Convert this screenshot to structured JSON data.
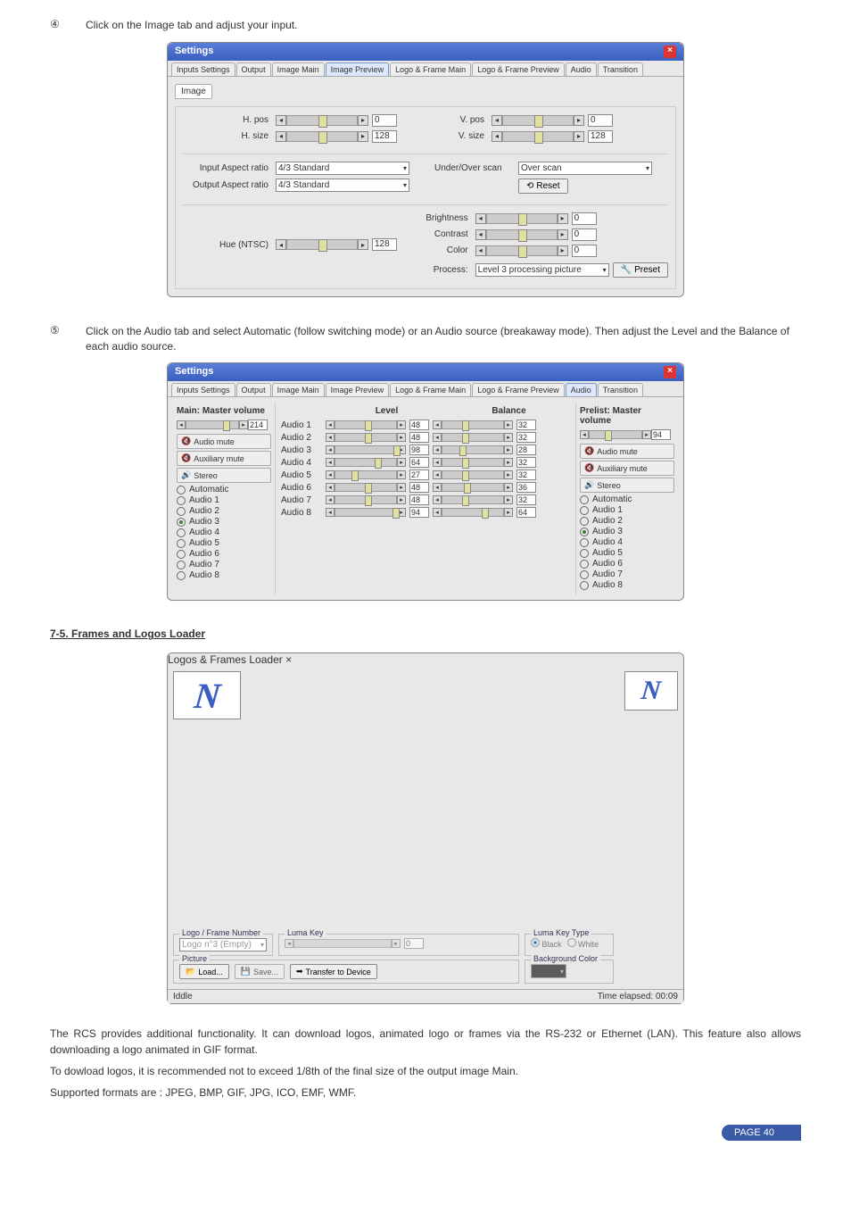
{
  "step4": {
    "num": "④",
    "text": "Click on the Image tab and adjust your input."
  },
  "step5": {
    "num": "⑤",
    "text": "Click on the Audio tab and select Automatic (follow switching mode) or an Audio source (breakaway mode). Then adjust the Level and the Balance of each audio source."
  },
  "settings_dialog": {
    "title": "Settings",
    "tabs": [
      "Inputs Settings",
      "Output",
      "Image Main",
      "Image Preview",
      "Logo & Frame Main",
      "Logo & Frame Preview",
      "Audio",
      "Transition"
    ],
    "subtab": "Image",
    "image": {
      "h_pos_label": "H. pos",
      "h_size_label": "H. size",
      "v_pos_label": "V. pos",
      "v_size_label": "V. size",
      "h_pos": "0",
      "h_size": "128",
      "v_pos": "0",
      "v_size": "128",
      "input_aspect_label": "Input Aspect ratio",
      "input_aspect": "4/3 Standard",
      "output_aspect_label": "Output Aspect ratio",
      "output_aspect": "4/3 Standard",
      "underover_label": "Under/Over scan",
      "underover": "Over scan",
      "reset_btn": "Reset",
      "hue_label": "Hue (NTSC)",
      "hue": "128",
      "brightness_label": "Brightness",
      "brightness": "0",
      "contrast_label": "Contrast",
      "contrast": "0",
      "color_label": "Color",
      "color": "0",
      "process_label": "Process:",
      "process": "Level 3 processing picture",
      "preset_btn": "Preset"
    }
  },
  "audio_dialog": {
    "title": "Settings",
    "tabs": [
      "Inputs Settings",
      "Output",
      "Image Main",
      "Image Preview",
      "Logo & Frame Main",
      "Logo & Frame Preview",
      "Audio",
      "Transition"
    ],
    "main_left": {
      "title": "Main: Master volume",
      "vol": "214",
      "mute": "Audio mute",
      "aux": "Auxiliary mute",
      "stereo": "Stereo",
      "sources": [
        "Automatic",
        "Audio 1",
        "Audio 2",
        "Audio 3",
        "Audio 4",
        "Audio 5",
        "Audio 6",
        "Audio 7",
        "Audio 8"
      ],
      "selected": "Audio 3"
    },
    "main_right": {
      "title": "Prelist: Master volume",
      "vol": "94",
      "mute": "Audio mute",
      "aux": "Auxiliary mute",
      "stereo": "Stereo",
      "sources": [
        "Automatic",
        "Audio 1",
        "Audio 2",
        "Audio 3",
        "Audio 4",
        "Audio 5",
        "Audio 6",
        "Audio 7",
        "Audio 8"
      ],
      "selected": "Audio 3"
    },
    "headers": {
      "level": "Level",
      "balance": "Balance"
    },
    "rows": [
      {
        "name": "Audio 1",
        "level": "48",
        "balance": "32"
      },
      {
        "name": "Audio 2",
        "level": "48",
        "balance": "32"
      },
      {
        "name": "Audio 3",
        "level": "98",
        "balance": "28"
      },
      {
        "name": "Audio 4",
        "level": "64",
        "balance": "32"
      },
      {
        "name": "Audio 5",
        "level": "27",
        "balance": "32"
      },
      {
        "name": "Audio 6",
        "level": "48",
        "balance": "36"
      },
      {
        "name": "Audio 7",
        "level": "48",
        "balance": "32"
      },
      {
        "name": "Audio 8",
        "level": "94",
        "balance": "64"
      }
    ]
  },
  "section75": "7-5. Frames and Logos Loader",
  "logos_dialog": {
    "title": "Logos & Frames Loader",
    "frame_number_label": "Logo / Frame Number",
    "frame_number": "Logo n°3 (Empty)",
    "luma_key_label": "Luma Key",
    "luma_key_val": "0",
    "luma_type_label": "Luma Key Type",
    "luma_black": "Black",
    "luma_white": "White",
    "picture_label": "Picture",
    "load_btn": "Load...",
    "save_btn": "Save...",
    "transfer_btn": "Transfer to Device",
    "bg_label": "Background Color",
    "status_left": "Iddle",
    "status_right": "Time elapsed: 00:09"
  },
  "para1": "The RCS provides additional functionality. It can download logos, animated logo or frames via the RS-232 or Ethernet (LAN). This feature also allows downloading a logo animated in GIF format.",
  "para2": "To dowload logos, it is recommended not to exceed 1/8th of the final size of the output image Main.",
  "para3": "Supported formats are : JPEG, BMP, GIF, JPG, ICO, EMF, WMF.",
  "page": "PAGE 40"
}
